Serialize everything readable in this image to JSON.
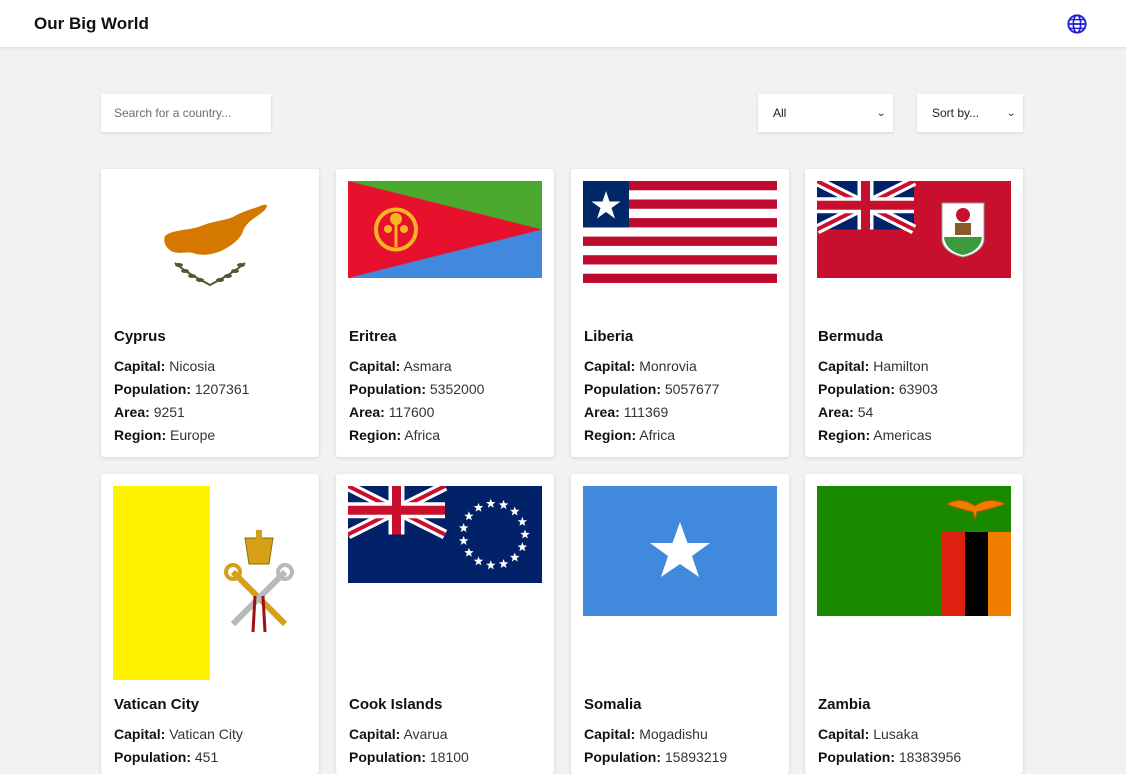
{
  "app": {
    "title": "Our Big World",
    "globe_icon": "globe-icon"
  },
  "controls": {
    "search_placeholder": "Search for a country...",
    "region_selected": "All",
    "sort_placeholder": "Sort by..."
  },
  "labels": {
    "capital": "Capital:",
    "population": "Population:",
    "area": "Area:",
    "region": "Region:"
  },
  "countries": [
    {
      "name": "Cyprus",
      "capital": "Nicosia",
      "population": "1207361",
      "area": "9251",
      "region": "Europe"
    },
    {
      "name": "Eritrea",
      "capital": "Asmara",
      "population": "5352000",
      "area": "117600",
      "region": "Africa"
    },
    {
      "name": "Liberia",
      "capital": "Monrovia",
      "population": "5057677",
      "area": "111369",
      "region": "Africa"
    },
    {
      "name": "Bermuda",
      "capital": "Hamilton",
      "population": "63903",
      "area": "54",
      "region": "Americas"
    },
    {
      "name": "Vatican City",
      "capital": "Vatican City",
      "population": "451",
      "area": "",
      "region": ""
    },
    {
      "name": "Cook Islands",
      "capital": "Avarua",
      "population": "18100",
      "area": "",
      "region": ""
    },
    {
      "name": "Somalia",
      "capital": "Mogadishu",
      "population": "15893219",
      "area": "",
      "region": ""
    },
    {
      "name": "Zambia",
      "capital": "Lusaka",
      "population": "18383956",
      "area": "",
      "region": ""
    }
  ]
}
